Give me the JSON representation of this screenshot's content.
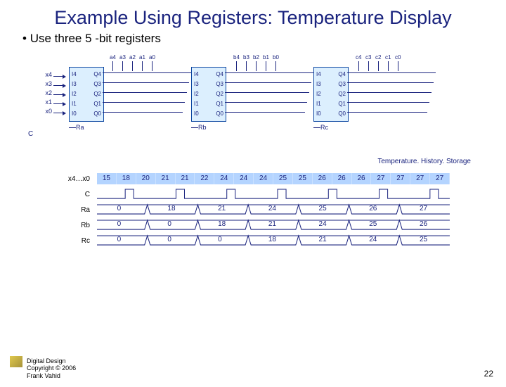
{
  "title": "Example Using Registers: Temperature Display",
  "bullet": "Use three 5 -bit registers",
  "inputs": [
    "x4",
    "x3",
    "x2",
    "x1",
    "x0"
  ],
  "cLabel": "C",
  "regs": [
    {
      "i": [
        "I4",
        "I3",
        "I2",
        "I1",
        "I0"
      ],
      "q": [
        "Q4",
        "Q3",
        "Q2",
        "Q1",
        "Q0"
      ],
      "name": "Ra",
      "top": [
        "a4",
        "a3",
        "a2",
        "a1",
        "a0"
      ]
    },
    {
      "i": [
        "I4",
        "I3",
        "I2",
        "I1",
        "I0"
      ],
      "q": [
        "Q4",
        "Q3",
        "Q2",
        "Q1",
        "Q0"
      ],
      "name": "Rb",
      "top": [
        "b4",
        "b3",
        "b2",
        "b1",
        "b0"
      ]
    },
    {
      "i": [
        "I4",
        "I3",
        "I2",
        "I1",
        "I0"
      ],
      "q": [
        "Q4",
        "Q3",
        "Q2",
        "Q1",
        "Q0"
      ],
      "name": "Rc",
      "top": [
        "c4",
        "c3",
        "c2",
        "c1",
        "c0"
      ]
    }
  ],
  "subtitle": "Temperature. History. Storage",
  "seq": {
    "streamLabel": "x4…x0",
    "stream": [
      "15",
      "18",
      "20",
      "21",
      "21",
      "22",
      "24",
      "24",
      "24",
      "25",
      "25",
      "26",
      "26",
      "26",
      "27",
      "27",
      "27",
      "27"
    ],
    "rows": [
      {
        "name": "C"
      },
      {
        "name": "Ra",
        "v": [
          "0",
          "18",
          "21",
          "24",
          "25",
          "26",
          "27"
        ]
      },
      {
        "name": "Rb",
        "v": [
          "0",
          "0",
          "18",
          "21",
          "24",
          "25",
          "26"
        ]
      },
      {
        "name": "Rc",
        "v": [
          "0",
          "0",
          "0",
          "18",
          "21",
          "24",
          "25"
        ]
      }
    ]
  },
  "footer": {
    "l1": "Digital Design",
    "l2": "Copyright © 2006",
    "l3": "Frank Vahid"
  },
  "page": "22"
}
